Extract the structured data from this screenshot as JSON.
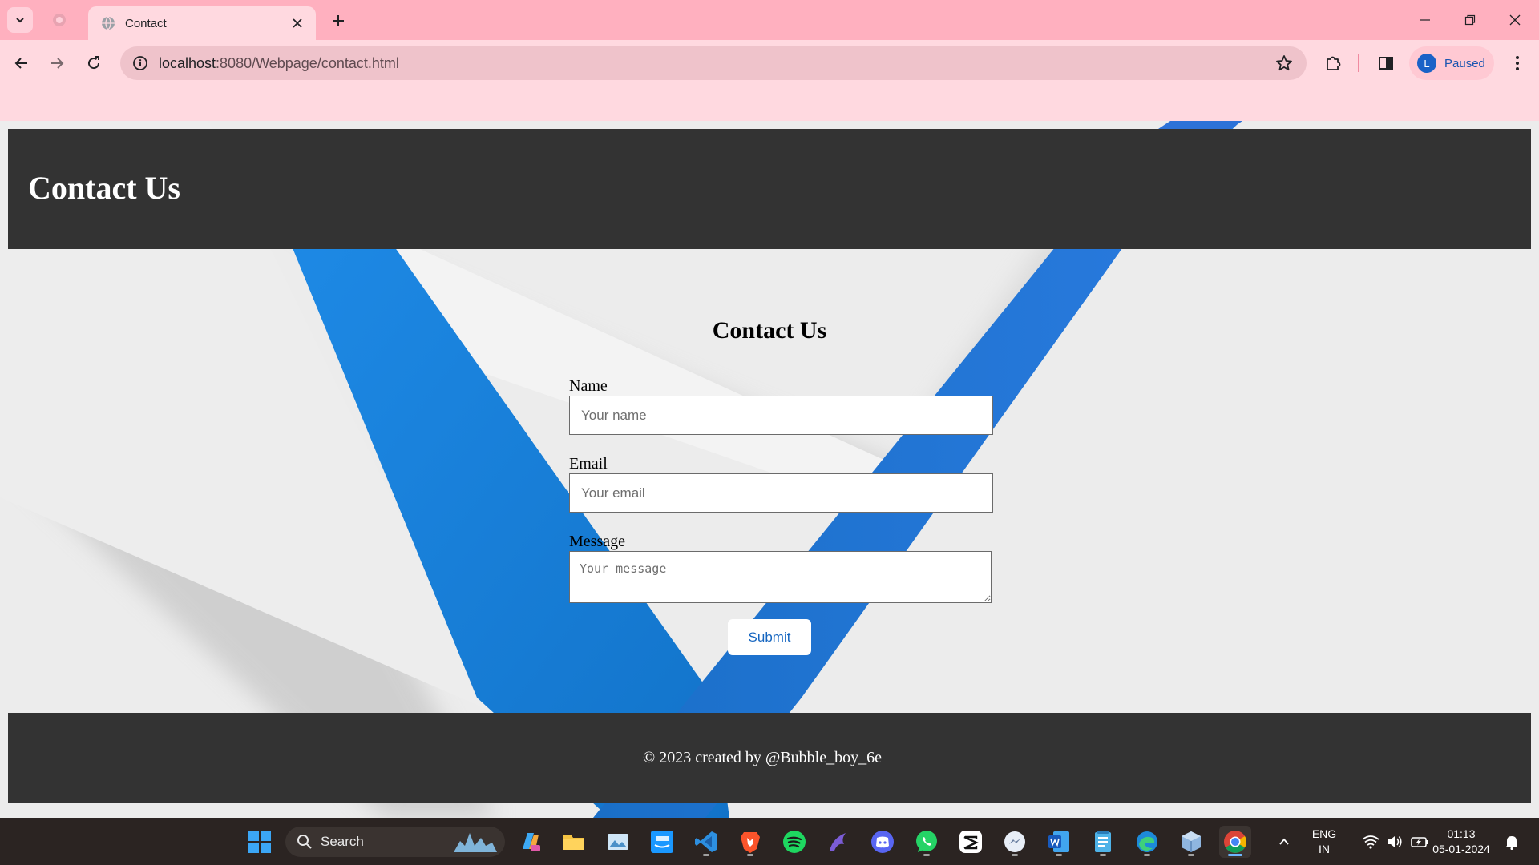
{
  "browser": {
    "tab_title": "Contact",
    "url_host": "localhost",
    "url_path": ":8080/Webpage/contact.html",
    "profile_initial": "L",
    "profile_status": "Paused"
  },
  "page": {
    "header_title": "Contact Us",
    "form_title": "Contact Us",
    "name_label": "Name",
    "name_placeholder": "Your name",
    "email_label": "Email",
    "email_placeholder": "Your email",
    "message_label": "Message",
    "message_placeholder": "Your message",
    "submit_label": "Submit",
    "footer_text": "© 2023 created by @Bubble_boy_6e"
  },
  "taskbar": {
    "search_label": "Search",
    "apps": [
      "windows-start",
      "search",
      "copilot",
      "file-explorer",
      "photos",
      "prime-video",
      "vscode",
      "brave",
      "spotify",
      "stremio",
      "discord",
      "whatsapp",
      "capcut",
      "messenger",
      "word",
      "notepad",
      "edge",
      "virtualbox",
      "chrome"
    ],
    "lang_top": "ENG",
    "lang_bottom": "IN",
    "time": "01:13",
    "date": "05-01-2024"
  },
  "colors": {
    "tabstrip": "#ffb0bf",
    "toolbar": "#ffd9e0",
    "header_footer": "#333333",
    "accent_blue": "#1a7bd4"
  }
}
